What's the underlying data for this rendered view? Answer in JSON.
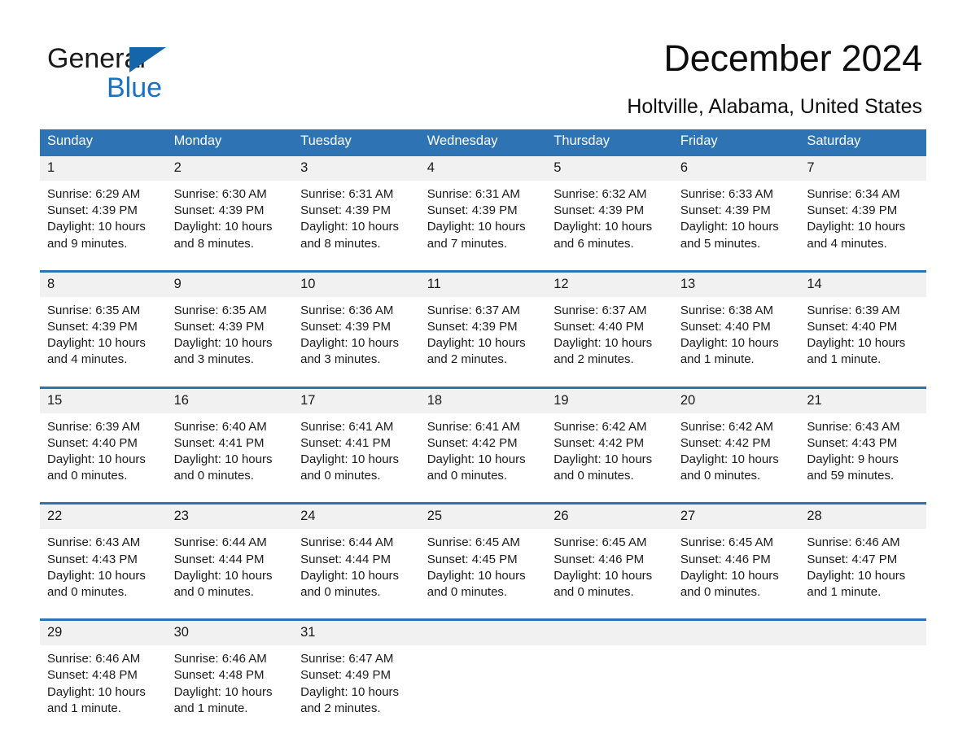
{
  "logo": {
    "word_one": "General",
    "word_two": "Blue",
    "triangle_color": "#1565a8",
    "blue_text_color": "#1a72c4"
  },
  "header": {
    "title": "December 2024",
    "location": "Holtville, Alabama, United States"
  },
  "theme": {
    "header_blue": "#2e74b5",
    "daynum_band": "#f1f1f1",
    "text": "#1a1a1a"
  },
  "weekdays": [
    "Sunday",
    "Monday",
    "Tuesday",
    "Wednesday",
    "Thursday",
    "Friday",
    "Saturday"
  ],
  "weeks": [
    [
      {
        "day": "1",
        "sunrise": "Sunrise: 6:29 AM",
        "sunset": "Sunset: 4:39 PM",
        "daylight": "Daylight: 10 hours and 9 minutes."
      },
      {
        "day": "2",
        "sunrise": "Sunrise: 6:30 AM",
        "sunset": "Sunset: 4:39 PM",
        "daylight": "Daylight: 10 hours and 8 minutes."
      },
      {
        "day": "3",
        "sunrise": "Sunrise: 6:31 AM",
        "sunset": "Sunset: 4:39 PM",
        "daylight": "Daylight: 10 hours and 8 minutes."
      },
      {
        "day": "4",
        "sunrise": "Sunrise: 6:31 AM",
        "sunset": "Sunset: 4:39 PM",
        "daylight": "Daylight: 10 hours and 7 minutes."
      },
      {
        "day": "5",
        "sunrise": "Sunrise: 6:32 AM",
        "sunset": "Sunset: 4:39 PM",
        "daylight": "Daylight: 10 hours and 6 minutes."
      },
      {
        "day": "6",
        "sunrise": "Sunrise: 6:33 AM",
        "sunset": "Sunset: 4:39 PM",
        "daylight": "Daylight: 10 hours and 5 minutes."
      },
      {
        "day": "7",
        "sunrise": "Sunrise: 6:34 AM",
        "sunset": "Sunset: 4:39 PM",
        "daylight": "Daylight: 10 hours and 4 minutes."
      }
    ],
    [
      {
        "day": "8",
        "sunrise": "Sunrise: 6:35 AM",
        "sunset": "Sunset: 4:39 PM",
        "daylight": "Daylight: 10 hours and 4 minutes."
      },
      {
        "day": "9",
        "sunrise": "Sunrise: 6:35 AM",
        "sunset": "Sunset: 4:39 PM",
        "daylight": "Daylight: 10 hours and 3 minutes."
      },
      {
        "day": "10",
        "sunrise": "Sunrise: 6:36 AM",
        "sunset": "Sunset: 4:39 PM",
        "daylight": "Daylight: 10 hours and 3 minutes."
      },
      {
        "day": "11",
        "sunrise": "Sunrise: 6:37 AM",
        "sunset": "Sunset: 4:39 PM",
        "daylight": "Daylight: 10 hours and 2 minutes."
      },
      {
        "day": "12",
        "sunrise": "Sunrise: 6:37 AM",
        "sunset": "Sunset: 4:40 PM",
        "daylight": "Daylight: 10 hours and 2 minutes."
      },
      {
        "day": "13",
        "sunrise": "Sunrise: 6:38 AM",
        "sunset": "Sunset: 4:40 PM",
        "daylight": "Daylight: 10 hours and 1 minute."
      },
      {
        "day": "14",
        "sunrise": "Sunrise: 6:39 AM",
        "sunset": "Sunset: 4:40 PM",
        "daylight": "Daylight: 10 hours and 1 minute."
      }
    ],
    [
      {
        "day": "15",
        "sunrise": "Sunrise: 6:39 AM",
        "sunset": "Sunset: 4:40 PM",
        "daylight": "Daylight: 10 hours and 0 minutes."
      },
      {
        "day": "16",
        "sunrise": "Sunrise: 6:40 AM",
        "sunset": "Sunset: 4:41 PM",
        "daylight": "Daylight: 10 hours and 0 minutes."
      },
      {
        "day": "17",
        "sunrise": "Sunrise: 6:41 AM",
        "sunset": "Sunset: 4:41 PM",
        "daylight": "Daylight: 10 hours and 0 minutes."
      },
      {
        "day": "18",
        "sunrise": "Sunrise: 6:41 AM",
        "sunset": "Sunset: 4:42 PM",
        "daylight": "Daylight: 10 hours and 0 minutes."
      },
      {
        "day": "19",
        "sunrise": "Sunrise: 6:42 AM",
        "sunset": "Sunset: 4:42 PM",
        "daylight": "Daylight: 10 hours and 0 minutes."
      },
      {
        "day": "20",
        "sunrise": "Sunrise: 6:42 AM",
        "sunset": "Sunset: 4:42 PM",
        "daylight": "Daylight: 10 hours and 0 minutes."
      },
      {
        "day": "21",
        "sunrise": "Sunrise: 6:43 AM",
        "sunset": "Sunset: 4:43 PM",
        "daylight": "Daylight: 9 hours and 59 minutes."
      }
    ],
    [
      {
        "day": "22",
        "sunrise": "Sunrise: 6:43 AM",
        "sunset": "Sunset: 4:43 PM",
        "daylight": "Daylight: 10 hours and 0 minutes."
      },
      {
        "day": "23",
        "sunrise": "Sunrise: 6:44 AM",
        "sunset": "Sunset: 4:44 PM",
        "daylight": "Daylight: 10 hours and 0 minutes."
      },
      {
        "day": "24",
        "sunrise": "Sunrise: 6:44 AM",
        "sunset": "Sunset: 4:44 PM",
        "daylight": "Daylight: 10 hours and 0 minutes."
      },
      {
        "day": "25",
        "sunrise": "Sunrise: 6:45 AM",
        "sunset": "Sunset: 4:45 PM",
        "daylight": "Daylight: 10 hours and 0 minutes."
      },
      {
        "day": "26",
        "sunrise": "Sunrise: 6:45 AM",
        "sunset": "Sunset: 4:46 PM",
        "daylight": "Daylight: 10 hours and 0 minutes."
      },
      {
        "day": "27",
        "sunrise": "Sunrise: 6:45 AM",
        "sunset": "Sunset: 4:46 PM",
        "daylight": "Daylight: 10 hours and 0 minutes."
      },
      {
        "day": "28",
        "sunrise": "Sunrise: 6:46 AM",
        "sunset": "Sunset: 4:47 PM",
        "daylight": "Daylight: 10 hours and 1 minute."
      }
    ],
    [
      {
        "day": "29",
        "sunrise": "Sunrise: 6:46 AM",
        "sunset": "Sunset: 4:48 PM",
        "daylight": "Daylight: 10 hours and 1 minute."
      },
      {
        "day": "30",
        "sunrise": "Sunrise: 6:46 AM",
        "sunset": "Sunset: 4:48 PM",
        "daylight": "Daylight: 10 hours and 1 minute."
      },
      {
        "day": "31",
        "sunrise": "Sunrise: 6:47 AM",
        "sunset": "Sunset: 4:49 PM",
        "daylight": "Daylight: 10 hours and 2 minutes."
      },
      {
        "day": "",
        "sunrise": "",
        "sunset": "",
        "daylight": ""
      },
      {
        "day": "",
        "sunrise": "",
        "sunset": "",
        "daylight": ""
      },
      {
        "day": "",
        "sunrise": "",
        "sunset": "",
        "daylight": ""
      },
      {
        "day": "",
        "sunrise": "",
        "sunset": "",
        "daylight": ""
      }
    ]
  ]
}
